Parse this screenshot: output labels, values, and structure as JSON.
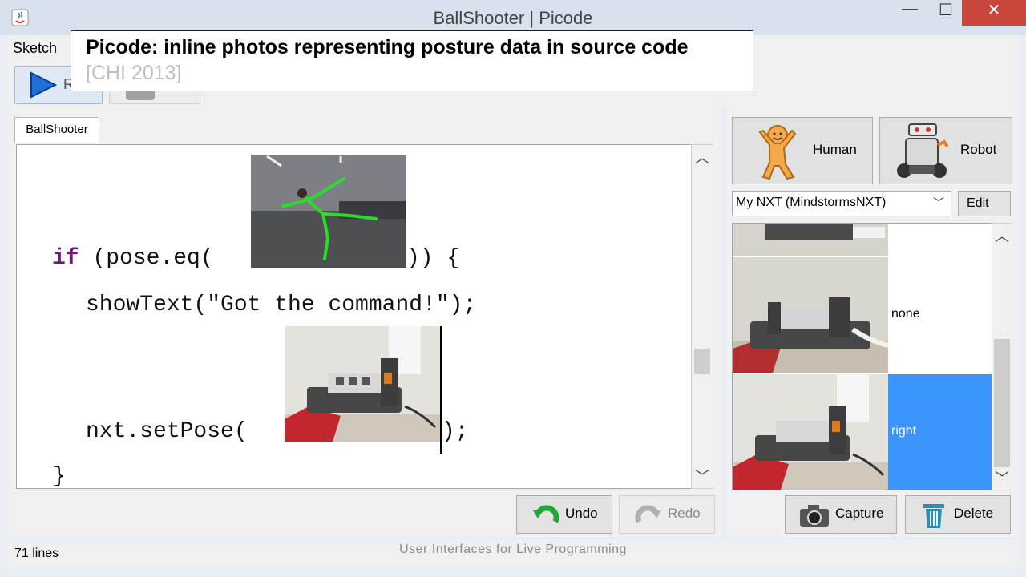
{
  "window": {
    "title": "BallShooter | Picode",
    "minimize": "—",
    "maximize": "☐",
    "close": "✕"
  },
  "menu": {
    "sketch_label": "Sketch",
    "sketch_mnemonic": "S"
  },
  "toolbar": {
    "run_label": "Run"
  },
  "callout": {
    "title": "Picode: inline photos representing posture data in source code",
    "subtitle": "[CHI 2013]"
  },
  "editor": {
    "tab": "BallShooter",
    "lines": [
      {
        "kw": "if",
        "text": " (pose.eq(",
        "tail": ")) {"
      },
      {
        "text": "showText(\"Got the command!\");"
      },
      {
        "text": "nxt.setPose(",
        "tail": ");"
      },
      {
        "text": "}"
      }
    ]
  },
  "actions": {
    "undo": "Undo",
    "redo": "Redo"
  },
  "status": {
    "lines": "71 lines"
  },
  "footer": "User Interfaces for Live Programming",
  "right": {
    "human": "Human",
    "robot": "Robot",
    "device": "My NXT (MindstormsNXT)",
    "edit": "Edit",
    "poses": [
      {
        "label": ""
      },
      {
        "label": "none"
      },
      {
        "label": "right"
      }
    ],
    "selected_pose": "right",
    "capture": "Capture",
    "delete": "Delete"
  },
  "colors": {
    "accent": "#3c95ff",
    "keyword": "#6b1a73",
    "skeleton": "#2adc2a",
    "close": "#c9463d"
  },
  "icons": [
    "java-icon",
    "play-icon",
    "human-icon",
    "robot-icon",
    "undo-icon",
    "redo-icon",
    "camera-icon",
    "trash-icon"
  ]
}
